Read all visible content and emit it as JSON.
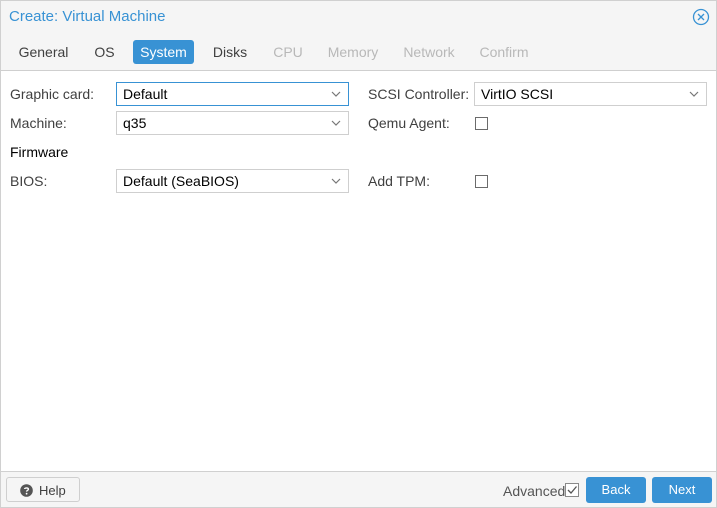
{
  "dialog": {
    "title": "Create: Virtual Machine"
  },
  "tabs": [
    {
      "label": "General",
      "state": "normal"
    },
    {
      "label": "OS",
      "state": "normal"
    },
    {
      "label": "System",
      "state": "active"
    },
    {
      "label": "Disks",
      "state": "normal"
    },
    {
      "label": "CPU",
      "state": "disabled"
    },
    {
      "label": "Memory",
      "state": "disabled"
    },
    {
      "label": "Network",
      "state": "disabled"
    },
    {
      "label": "Confirm",
      "state": "disabled"
    }
  ],
  "form": {
    "graphic_card": {
      "label": "Graphic card:",
      "value": "Default"
    },
    "machine": {
      "label": "Machine:",
      "value": "q35"
    },
    "firmware_heading": "Firmware",
    "bios": {
      "label": "BIOS:",
      "value": "Default (SeaBIOS)"
    },
    "scsi_controller": {
      "label": "SCSI Controller:",
      "value": "VirtIO SCSI"
    },
    "qemu_agent": {
      "label": "Qemu Agent:",
      "checked": false
    },
    "add_tpm": {
      "label": "Add TPM:",
      "checked": false
    }
  },
  "footer": {
    "help_label": "Help",
    "advanced_label": "Advanced",
    "advanced_checked": true,
    "back_label": "Back",
    "next_label": "Next"
  },
  "colors": {
    "accent": "#3892d4",
    "panel_bg": "#f5f5f5"
  },
  "icons": {
    "close": "close-circle-icon",
    "dropdown": "chevron-down-icon",
    "help": "question-circle-icon"
  }
}
